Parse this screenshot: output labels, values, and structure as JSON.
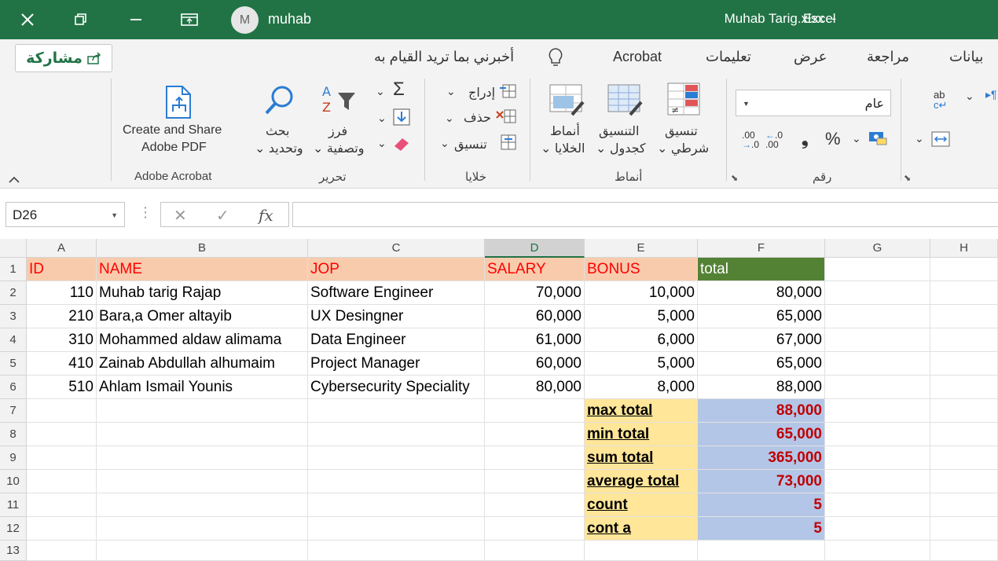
{
  "titlebar": {
    "user_initial": "M",
    "user_name": "muhab",
    "doc_title": "Muhab Tarig.xlsx  -",
    "app_name": "Excel"
  },
  "ribbon": {
    "share_label": "مشاركة",
    "tabs": [
      "بيانات",
      "مراجعة",
      "عرض",
      "تعليمات",
      "Acrobat"
    ],
    "tell_me": "أخبرني بما تريد القيام به",
    "acrobat": {
      "line1": "Create and Share",
      "line2": "Adobe PDF",
      "group": "Adobe Acrobat"
    },
    "editing": {
      "search_line1": "بحث",
      "search_line2": "وتحديد",
      "sort_line1": "فرز",
      "sort_line2": "وتصفية",
      "group": "تحرير"
    },
    "cells": {
      "insert": "إدراج",
      "delete": "حذف",
      "format": "تنسيق",
      "group": "خلايا"
    },
    "styles": {
      "cell_line1": "أنماط",
      "cell_line2": "الخلايا",
      "table_line1": "التنسيق",
      "table_line2": "كجدول",
      "cond_line1": "تنسيق",
      "cond_line2": "شرطي",
      "group": "أنماط"
    },
    "number": {
      "format_value": "عام",
      "group": "رقم",
      "percent": "%",
      "comma": "❟"
    }
  },
  "formula_bar": {
    "cell_ref": "D26",
    "fx": "fx",
    "value": ""
  },
  "sheet": {
    "columns": [
      "A",
      "B",
      "C",
      "D",
      "E",
      "F",
      "G",
      "H"
    ],
    "selected_column": "D",
    "rows": [
      "1",
      "2",
      "3",
      "4",
      "5",
      "6",
      "7",
      "8",
      "9",
      "10",
      "11",
      "12",
      "13"
    ],
    "headers": {
      "id": "ID",
      "name": "NAME",
      "job": "JOP",
      "salary": "SALARY",
      "bonus": "BONUS",
      "total": "total"
    },
    "employees": [
      {
        "id": "110",
        "name": "Muhab tarig Rajap",
        "job": "Software Engineer",
        "salary": "70,000",
        "bonus": "10,000",
        "total": "80,000"
      },
      {
        "id": "210",
        "name": "Bara,a Omer altayib",
        "job": "UX Desingner",
        "salary": "60,000",
        "bonus": "5,000",
        "total": "65,000"
      },
      {
        "id": "310",
        "name": "Mohammed aldaw alimama",
        "job": "Data Engineer",
        "salary": "61,000",
        "bonus": "6,000",
        "total": "67,000"
      },
      {
        "id": "410",
        "name": " Zainab Abdullah alhumaim",
        "job": "Project Manager",
        "salary": "60,000",
        "bonus": "5,000",
        "total": "65,000"
      },
      {
        "id": "510",
        "name": "Ahlam Ismail Younis",
        "job": "Cybersecurity Speciality",
        "salary": "80,000",
        "bonus": "8,000",
        "total": "88,000"
      }
    ],
    "stats": [
      {
        "label": "max total",
        "value": "88,000"
      },
      {
        "label": "min total",
        "value": "65,000"
      },
      {
        "label": "sum total",
        "value": "365,000"
      },
      {
        "label": "average total",
        "value": "73,000"
      },
      {
        "label": "count",
        "value": "5"
      },
      {
        "label": "cont a",
        "value": "5"
      }
    ]
  },
  "colors": {
    "excel_green": "#217346",
    "header_fill": "#f8cbad",
    "total_header_fill": "#548235",
    "stat_label_fill": "#ffe699",
    "stat_value_fill": "#b4c6e7",
    "stat_value_text": "#c00000"
  }
}
